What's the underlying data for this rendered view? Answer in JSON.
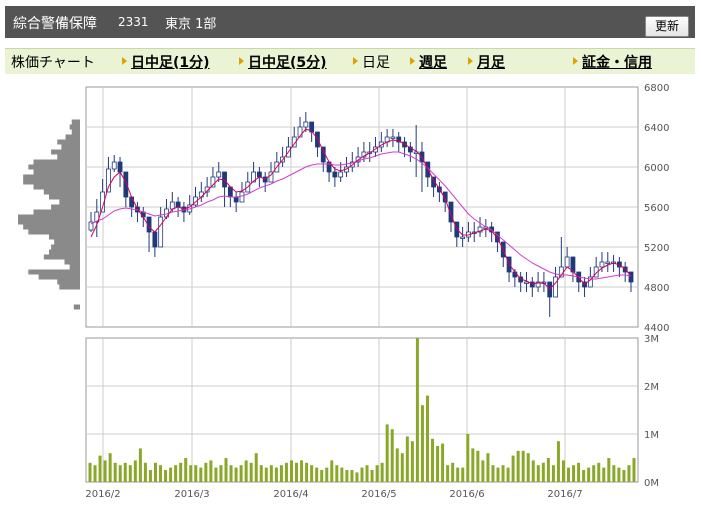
{
  "header": {
    "title": "綜合警備保障",
    "code": "2331",
    "market": "東京 1部",
    "refresh_label": "更新"
  },
  "tabs": [
    {
      "label": "株価チャート",
      "arrow": false,
      "link": false
    },
    {
      "label": "日中足(1分)",
      "arrow": true,
      "link": true
    },
    {
      "label": "日中足(5分)",
      "arrow": true,
      "link": true
    },
    {
      "label": "日足",
      "arrow": true,
      "link": false
    },
    {
      "label": "週足",
      "arrow": true,
      "link": true
    },
    {
      "label": "月足",
      "arrow": true,
      "link": true
    },
    {
      "label": "証金・信用",
      "arrow": true,
      "link": true
    }
  ],
  "colors": {
    "candle": "#1f3a7a",
    "ma_short": "#d00060",
    "ma_long": "#d040d0",
    "volume": "#8aa828",
    "volume_profile": "#8a8a8a",
    "grid": "#cccccc"
  },
  "chart_data": [
    {
      "type": "candlestick",
      "title": "",
      "xlabel": "",
      "ylabel": "",
      "ylim": [
        4400,
        6800
      ],
      "y_ticks": [
        "6800",
        "6400",
        "6000",
        "5600",
        "5200",
        "4800",
        "4400"
      ],
      "x_ticks": [
        "2016/2",
        "2016/3",
        "2016/4",
        "2016/5",
        "2016/6",
        "2016/7"
      ],
      "close": [
        5450,
        5550,
        5750,
        5980,
        6050,
        5950,
        5700,
        5600,
        5550,
        5500,
        5350,
        5200,
        5500,
        5580,
        5650,
        5600,
        5550,
        5620,
        5700,
        5750,
        5800,
        5900,
        5950,
        5800,
        5700,
        5650,
        5750,
        5850,
        5950,
        5900,
        5850,
        5950,
        6050,
        6100,
        6200,
        6300,
        6400,
        6450,
        6350,
        6200,
        6050,
        5950,
        5900,
        5950,
        6000,
        6050,
        6100,
        6150,
        6150,
        6200,
        6250,
        6300,
        6300,
        6250,
        6200,
        6150,
        6150,
        6050,
        5900,
        5800,
        5750,
        5650,
        5450,
        5300,
        5300,
        5350,
        5350,
        5400,
        5400,
        5350,
        5250,
        5100,
        4950,
        4900,
        4850,
        4850,
        4800,
        4850,
        4850,
        4700,
        4900,
        5000,
        5100,
        4950,
        4850,
        4800,
        4900,
        5000,
        5050,
        5050,
        5050,
        5000,
        4950,
        4850
      ],
      "high": [
        5550,
        5680,
        5880,
        6100,
        6120,
        6100,
        5850,
        5700,
        5650,
        5600,
        5450,
        5300,
        5600,
        5680,
        5750,
        5700,
        5650,
        5720,
        5800,
        5850,
        5900,
        6000,
        6050,
        5900,
        5800,
        5750,
        5850,
        5950,
        6050,
        6000,
        5950,
        6050,
        6150,
        6200,
        6300,
        6400,
        6500,
        6550,
        6450,
        6300,
        6150,
        6050,
        6000,
        6050,
        6100,
        6150,
        6200,
        6250,
        6250,
        6300,
        6350,
        6380,
        6380,
        6350,
        6300,
        6250,
        6420,
        6250,
        6000,
        5900,
        5850,
        5750,
        5550,
        5420,
        5400,
        5450,
        5450,
        5500,
        5480,
        5450,
        5350,
        5200,
        5050,
        4980,
        4950,
        4950,
        4900,
        4950,
        4950,
        4850,
        5000,
        5300,
        5200,
        5050,
        4950,
        4900,
        5000,
        5100,
        5150,
        5150,
        5120,
        5100,
        5050,
        4950
      ],
      "low": [
        5350,
        5300,
        5650,
        5880,
        5950,
        5800,
        5600,
        5500,
        5450,
        5400,
        5150,
        5100,
        5400,
        5480,
        5550,
        5500,
        5450,
        5520,
        5600,
        5650,
        5700,
        5800,
        5850,
        5600,
        5600,
        5550,
        5650,
        5750,
        5850,
        5800,
        5750,
        5850,
        5950,
        6000,
        6100,
        6200,
        6300,
        6350,
        6250,
        6100,
        5950,
        5850,
        5800,
        5850,
        5900,
        5950,
        6000,
        6050,
        6050,
        6100,
        6150,
        6200,
        6200,
        6150,
        6100,
        6050,
        5900,
        5750,
        5800,
        5700,
        5650,
        5550,
        5350,
        5200,
        5200,
        5250,
        5250,
        5300,
        5300,
        5250,
        5150,
        5000,
        4850,
        4800,
        4750,
        4750,
        4700,
        4750,
        4750,
        4500,
        4800,
        4900,
        5000,
        4850,
        4750,
        4700,
        4800,
        4900,
        4950,
        4950,
        4950,
        4900,
        4850,
        4750
      ],
      "ma_short": [
        5300,
        5420,
        5600,
        5800,
        5900,
        5950,
        5850,
        5700,
        5580,
        5500,
        5400,
        5350,
        5420,
        5500,
        5580,
        5600,
        5580,
        5600,
        5650,
        5700,
        5760,
        5820,
        5880,
        5870,
        5800,
        5750,
        5760,
        5800,
        5860,
        5900,
        5880,
        5920,
        6000,
        6070,
        6150,
        6230,
        6310,
        6380,
        6360,
        6280,
        6160,
        6050,
        5980,
        5960,
        5980,
        6020,
        6070,
        6110,
        6140,
        6180,
        6220,
        6250,
        6270,
        6260,
        6230,
        6190,
        6160,
        6100,
        5980,
        5870,
        5780,
        5680,
        5520,
        5380,
        5320,
        5320,
        5340,
        5360,
        5380,
        5360,
        5290,
        5170,
        5030,
        4950,
        4880,
        4860,
        4830,
        4840,
        4840,
        4780,
        4840,
        4920,
        5000,
        4960,
        4890,
        4830,
        4870,
        4940,
        4990,
        5020,
        5040,
        5020,
        4980,
        4910
      ],
      "ma_long": [
        5430,
        5460,
        5480,
        5520,
        5560,
        5580,
        5590,
        5580,
        5570,
        5550,
        5530,
        5510,
        5520,
        5530,
        5550,
        5560,
        5570,
        5580,
        5600,
        5620,
        5650,
        5670,
        5700,
        5710,
        5700,
        5700,
        5710,
        5730,
        5760,
        5790,
        5810,
        5830,
        5860,
        5880,
        5910,
        5940,
        5970,
        6000,
        6020,
        6030,
        6030,
        6030,
        6020,
        6020,
        6030,
        6040,
        6060,
        6080,
        6090,
        6110,
        6130,
        6140,
        6150,
        6150,
        6130,
        6110,
        6080,
        6040,
        5990,
        5930,
        5870,
        5810,
        5740,
        5670,
        5600,
        5530,
        5480,
        5440,
        5400,
        5370,
        5320,
        5270,
        5220,
        5170,
        5120,
        5080,
        5040,
        5010,
        4980,
        4950,
        4930,
        4920,
        4920,
        4910,
        4900,
        4890,
        4880,
        4880,
        4890,
        4900,
        4910,
        4920,
        4920,
        4910
      ],
      "volume_profile": [
        {
          "price": 6450,
          "size": 8
        },
        {
          "price": 6400,
          "size": 10
        },
        {
          "price": 6350,
          "size": 8
        },
        {
          "price": 6300,
          "size": 14
        },
        {
          "price": 6250,
          "size": 22
        },
        {
          "price": 6200,
          "size": 18
        },
        {
          "price": 6150,
          "size": 28
        },
        {
          "price": 6100,
          "size": 22
        },
        {
          "price": 6050,
          "size": 45
        },
        {
          "price": 6000,
          "size": 50
        },
        {
          "price": 5950,
          "size": 45
        },
        {
          "price": 5900,
          "size": 55
        },
        {
          "price": 5850,
          "size": 55
        },
        {
          "price": 5800,
          "size": 45
        },
        {
          "price": 5750,
          "size": 35
        },
        {
          "price": 5700,
          "size": 30
        },
        {
          "price": 5650,
          "size": 20
        },
        {
          "price": 5600,
          "size": 28
        },
        {
          "price": 5550,
          "size": 45
        },
        {
          "price": 5500,
          "size": 60
        },
        {
          "price": 5450,
          "size": 60
        },
        {
          "price": 5400,
          "size": 55
        },
        {
          "price": 5350,
          "size": 50
        },
        {
          "price": 5300,
          "size": 30
        },
        {
          "price": 5250,
          "size": 25
        },
        {
          "price": 5200,
          "size": 28
        },
        {
          "price": 5150,
          "size": 30
        },
        {
          "price": 5100,
          "size": 35
        },
        {
          "price": 5050,
          "size": 15
        },
        {
          "price": 5000,
          "size": 10
        },
        {
          "price": 4950,
          "size": 50
        },
        {
          "price": 4900,
          "size": 40
        },
        {
          "price": 4850,
          "size": 22
        },
        {
          "price": 4800,
          "size": 20
        },
        {
          "price": 4600,
          "size": 6
        }
      ]
    },
    {
      "type": "bar",
      "title": "",
      "xlabel": "",
      "ylabel": "",
      "ylim": [
        0,
        3000000
      ],
      "y_ticks": [
        "3M",
        "2M",
        "1M",
        "0M"
      ],
      "x_ticks": [
        "2016/2",
        "2016/3",
        "2016/4",
        "2016/5",
        "2016/6",
        "2016/7"
      ],
      "values": [
        400000,
        350000,
        550000,
        450000,
        600000,
        400000,
        350000,
        400000,
        350000,
        450000,
        700000,
        400000,
        250000,
        400000,
        350000,
        250000,
        300000,
        350000,
        400000,
        500000,
        350000,
        350000,
        300000,
        400000,
        450000,
        300000,
        350000,
        500000,
        350000,
        300000,
        350000,
        450000,
        400000,
        600000,
        350000,
        300000,
        350000,
        300000,
        350000,
        400000,
        450000,
        400000,
        450000,
        400000,
        350000,
        300000,
        250000,
        300000,
        450000,
        350000,
        300000,
        250000,
        250000,
        200000,
        300000,
        350000,
        250000,
        350000,
        400000,
        1200000,
        1100000,
        700000,
        600000,
        950000,
        850000,
        3000000,
        1600000,
        1800000,
        900000,
        750000,
        800000,
        350000,
        400000,
        300000,
        300000,
        1000000,
        700000,
        650000,
        450000,
        600000,
        350000,
        300000,
        350000,
        300000,
        550000,
        650000,
        650000,
        600000,
        450000,
        350000,
        400000,
        500000,
        350000,
        850000,
        450000,
        300000,
        350000,
        400000,
        250000,
        300000,
        350000,
        400000,
        300000,
        500000,
        350000,
        300000,
        250000,
        350000,
        500000
      ]
    }
  ]
}
